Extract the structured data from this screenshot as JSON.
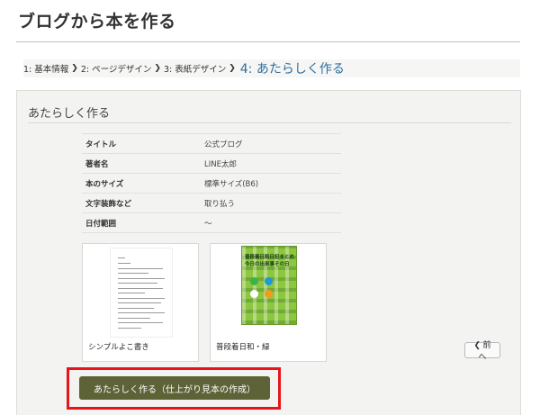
{
  "page": {
    "title": "ブログから本を作る"
  },
  "breadcrumb": {
    "steps": [
      {
        "label": "1: 基本情報"
      },
      {
        "label": "2: ページデザイン"
      },
      {
        "label": "3: 表紙デザイン"
      }
    ],
    "current": "4: あたらしく作る",
    "separator": "❯"
  },
  "panel": {
    "title": "あたらしく作る",
    "info": [
      {
        "label": "タイトル",
        "value": "公式ブログ"
      },
      {
        "label": "著者名",
        "value": "LINE太郎"
      },
      {
        "label": "本のサイズ",
        "value": "標準サイズ(B6)"
      },
      {
        "label": "文字装飾など",
        "value": "取り払う"
      },
      {
        "label": "日付範囲",
        "value": "～"
      }
    ],
    "cards": [
      {
        "label": "シンプルよこ書き"
      },
      {
        "label": "普段着日和・緑",
        "cover_line1": "普段着日和日記まとめ",
        "cover_line2": "今日の出来事その日"
      }
    ],
    "prev_button": "❮ 前へ",
    "create_button": "あたらしく作る（仕上がり見本の作成）"
  },
  "colors": {
    "accent_link": "#2f6f9f",
    "create_button_bg": "#5d6336",
    "highlight_frame": "#e8141a",
    "cover_green": "#8dc63f"
  }
}
